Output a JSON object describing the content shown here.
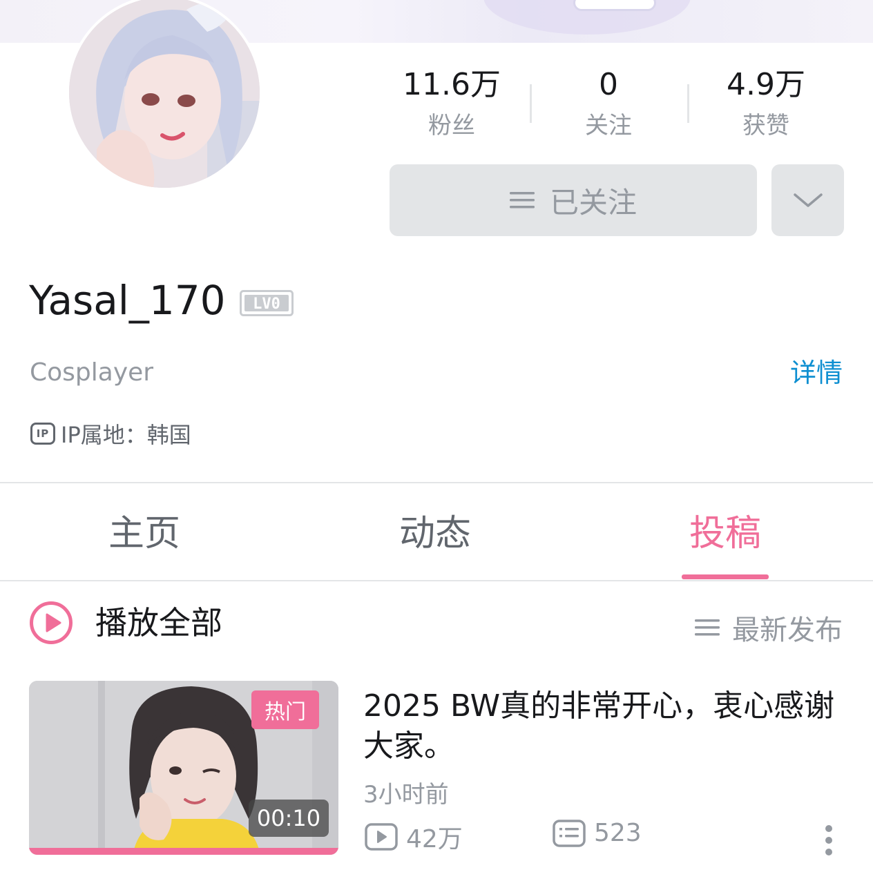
{
  "profile": {
    "username": "Yasal_170",
    "level": "LV0",
    "bio": "Cosplayer",
    "detail_link": "详情",
    "ip_badge": "IP",
    "ip_location": "IP属地：韩国"
  },
  "stats": [
    {
      "value": "11.6万",
      "label": "粉丝"
    },
    {
      "value": "0",
      "label": "关注"
    },
    {
      "value": "4.9万",
      "label": "获赞"
    }
  ],
  "actions": {
    "follow_label": "已关注",
    "follow_icon": "menu-lines-icon",
    "more_icon": "chevron-down-icon"
  },
  "tabs": [
    {
      "label": "主页",
      "active": false
    },
    {
      "label": "动态",
      "active": false
    },
    {
      "label": "投稿",
      "active": true
    }
  ],
  "toolbar": {
    "play_all_label": "播放全部",
    "sort_label": "最新发布"
  },
  "videos": [
    {
      "title": "2025 BW真的非常开心，衷心感谢大家。",
      "badge": "热门",
      "duration": "00:10",
      "published": "3小时前",
      "views": "42万",
      "comments": "523",
      "watch_progress": 1.0
    }
  ],
  "colors": {
    "accent_pink": "#f06e99",
    "link_blue": "#0e8fd1",
    "text_primary": "#18191c",
    "text_secondary": "#9499a0",
    "button_gray": "#e3e5e7"
  }
}
